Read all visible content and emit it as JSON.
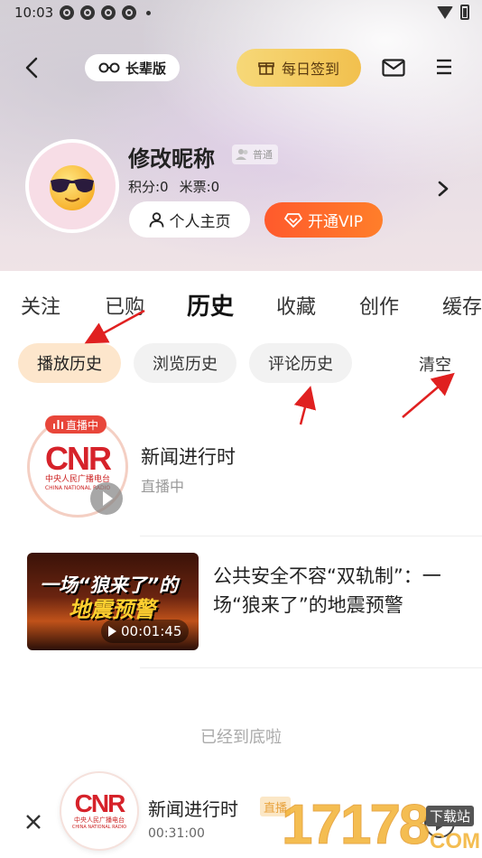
{
  "status_bar": {
    "time": "10:03"
  },
  "top_bar": {
    "elder_mode_label": "长辈版",
    "checkin_label": "每日签到"
  },
  "profile": {
    "nickname": "修改昵称",
    "level": "普通",
    "points": "积分:0",
    "mipiao": "米票:0",
    "home_button": "个人主页",
    "vip_button": "开通VIP"
  },
  "tabs": [
    {
      "label": "关注"
    },
    {
      "label": "已购"
    },
    {
      "label": "历史",
      "active": true
    },
    {
      "label": "收藏"
    },
    {
      "label": "创作"
    },
    {
      "label": "缓存"
    }
  ],
  "subtabs": [
    {
      "label": "播放历史",
      "active": true
    },
    {
      "label": "浏览历史"
    },
    {
      "label": "评论历史"
    }
  ],
  "clear_label": "清空",
  "history": [
    {
      "title": "新闻进行时",
      "subtitle": "直播中",
      "badge": "直播中",
      "logo_text": "CNR",
      "logo_sub": "中央人民广播电台",
      "logo_sub_en": "CHINA NATIONAL RADIO"
    },
    {
      "title": "公共安全不容“双轨制”：一场“狼来了”的地震预警",
      "thumb_line1": "一场“狼来了”的",
      "thumb_line2": "地震预警",
      "duration": "00:01:45"
    }
  ],
  "end_text": "已经到底啦",
  "player": {
    "title": "新闻进行时",
    "live_badge": "直播",
    "time": "00:31:00",
    "logo_text": "CNR",
    "logo_sub": "中央人民广播电台",
    "logo_sub_en": "CHINA NATIONAL RADIO"
  },
  "watermark": {
    "digits": "17178",
    "xz": "下载站",
    "com": "COM"
  },
  "colors": {
    "vip_orange": "#ff5a2c",
    "checkin_gold": "#f2c04e",
    "active_chip": "#fde6cc",
    "live_red": "#e8463a",
    "annotation_red": "#e02020"
  }
}
